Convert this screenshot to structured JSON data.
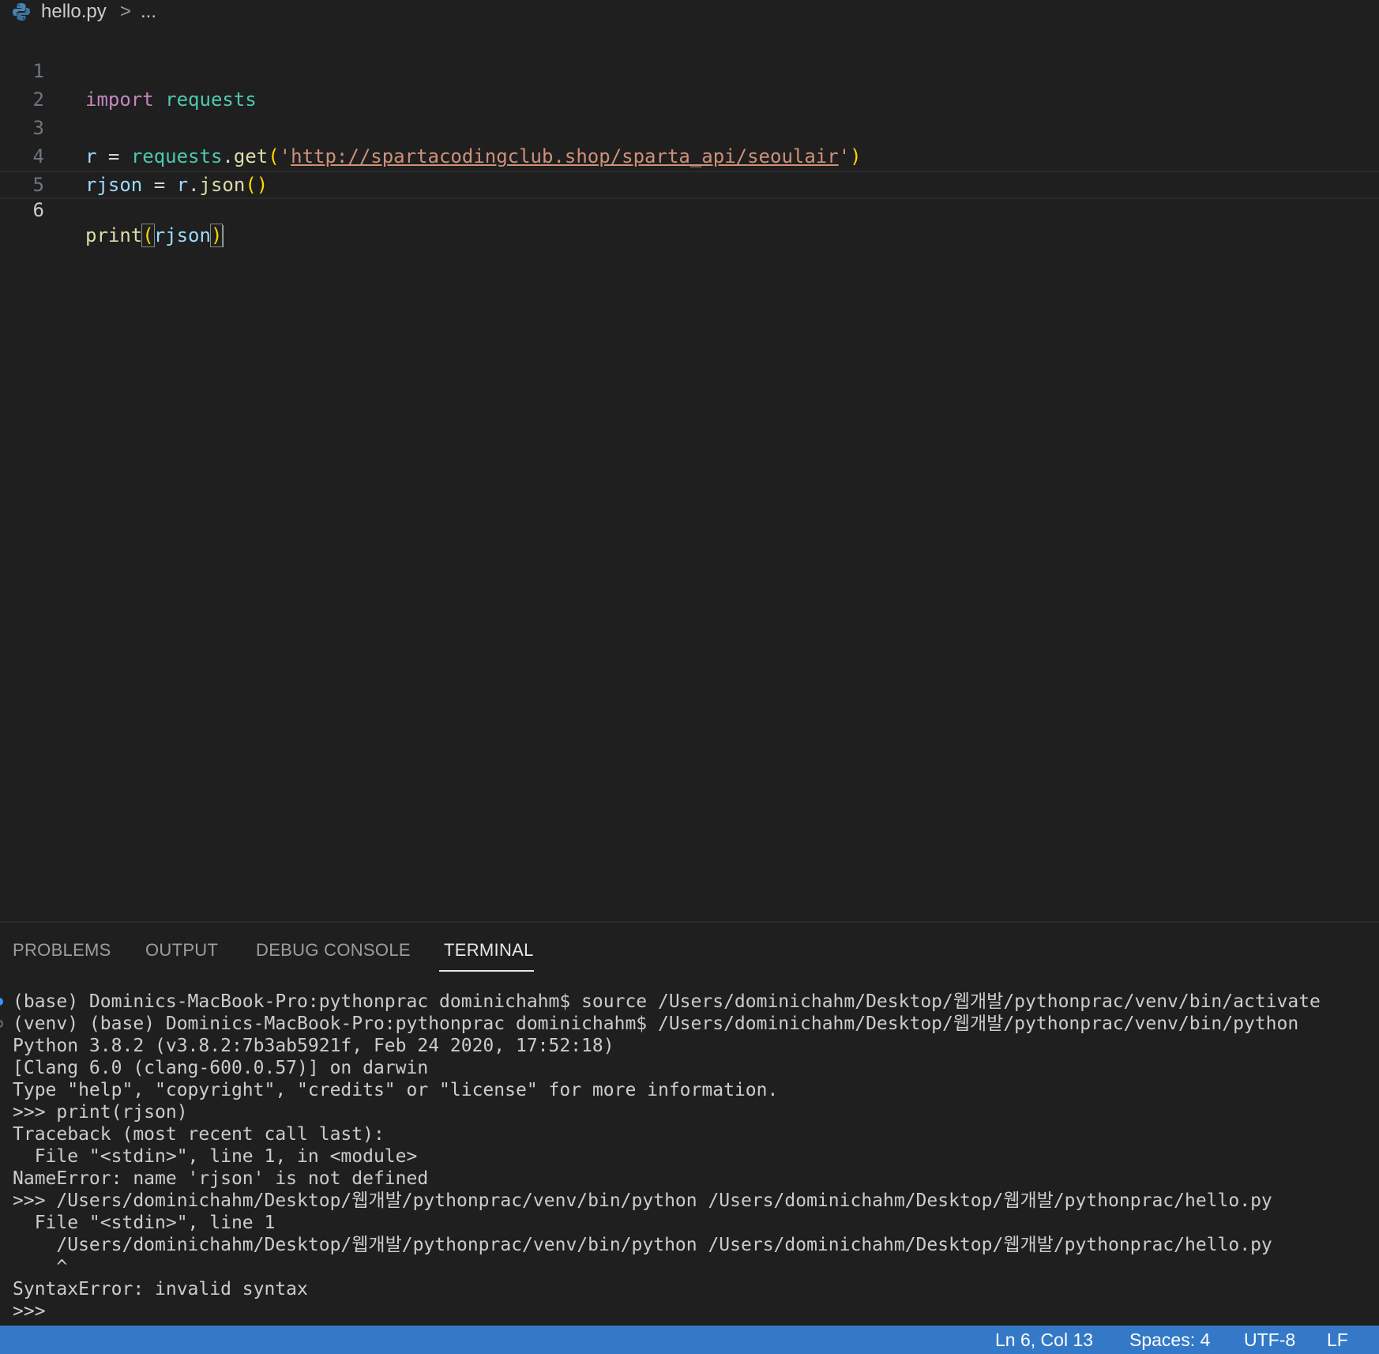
{
  "breadcrumb": {
    "file": "hello.py",
    "separator": ">",
    "more": "..."
  },
  "editor": {
    "line_numbers": [
      "1",
      "2",
      "3",
      "4",
      "5",
      "6"
    ],
    "line1": {
      "keyword": "import",
      "module": "requests"
    },
    "line3": {
      "var": "r",
      "eq": "=",
      "module": "requests",
      "dot": ".",
      "fn": "get",
      "open": "(",
      "quote1": "'",
      "url": "http://spartacodingclub.shop/sparta_api/seoulair",
      "quote2": "'",
      "close": ")"
    },
    "line4": {
      "var": "rjson",
      "eq": "=",
      "obj": "r",
      "dot": ".",
      "fn": "json",
      "parens": "()"
    },
    "line6": {
      "fn": "print",
      "open": "(",
      "arg": "rjson",
      "close": ")"
    }
  },
  "panel": {
    "tabs": [
      "PROBLEMS",
      "OUTPUT",
      "DEBUG CONSOLE",
      "TERMINAL"
    ],
    "active_tab": "TERMINAL"
  },
  "terminal": {
    "lines": [
      "(base) Dominics-MacBook-Pro:pythonprac dominichahm$ source /Users/dominichahm/Desktop/웹개발/pythonprac/venv/bin/activate",
      "(venv) (base) Dominics-MacBook-Pro:pythonprac dominichahm$ /Users/dominichahm/Desktop/웹개발/pythonprac/venv/bin/python",
      "Python 3.8.2 (v3.8.2:7b3ab5921f, Feb 24 2020, 17:52:18)",
      "[Clang 6.0 (clang-600.0.57)] on darwin",
      "Type \"help\", \"copyright\", \"credits\" or \"license\" for more information.",
      ">>> print(rjson)",
      "Traceback (most recent call last):",
      "  File \"<stdin>\", line 1, in <module>",
      "NameError: name 'rjson' is not defined",
      ">>> /Users/dominichahm/Desktop/웹개발/pythonprac/venv/bin/python /Users/dominichahm/Desktop/웹개발/pythonprac/hello.py",
      "  File \"<stdin>\", line 1",
      "    /Users/dominichahm/Desktop/웹개발/pythonprac/venv/bin/python /Users/dominichahm/Desktop/웹개발/pythonprac/hello.py",
      "    ^",
      "SyntaxError: invalid syntax",
      ">>>"
    ]
  },
  "statusbar": {
    "position": "Ln 6, Col 13",
    "indent": "Spaces: 4",
    "encoding": "UTF-8",
    "eol": "LF"
  },
  "colors": {
    "background": "#1f1f1f",
    "statusbar": "#3479c7",
    "keyword": "#c586c0",
    "module": "#4ec9b0",
    "variable": "#9cdcfe",
    "function": "#dcdcaa",
    "string": "#ce9178",
    "bracket": "#ffd700"
  }
}
